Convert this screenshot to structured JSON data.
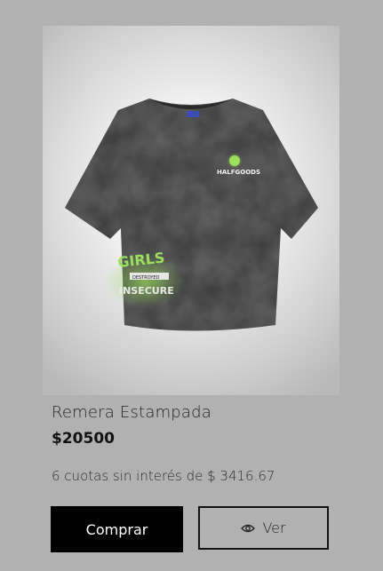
{
  "product": {
    "title": "Remera Estampada",
    "price": "$20500",
    "installments": "6 cuotas sin interés de $ 3416.67",
    "image": {
      "brand_text": "HALFGOODS",
      "graffiti_text_1": "GIRLS",
      "graffiti_text_2": "INSECURE",
      "tag_text": "DESTROYED",
      "shirt_color": "#3a3a3a",
      "print_color": "#8fd14f"
    }
  },
  "actions": {
    "buy_label": "Comprar",
    "view_label": "Ver",
    "view_icon": "eye-icon"
  },
  "colors": {
    "background": "#b1b1b1",
    "buy_button_bg": "#000000",
    "buy_button_text": "#ffffff"
  }
}
